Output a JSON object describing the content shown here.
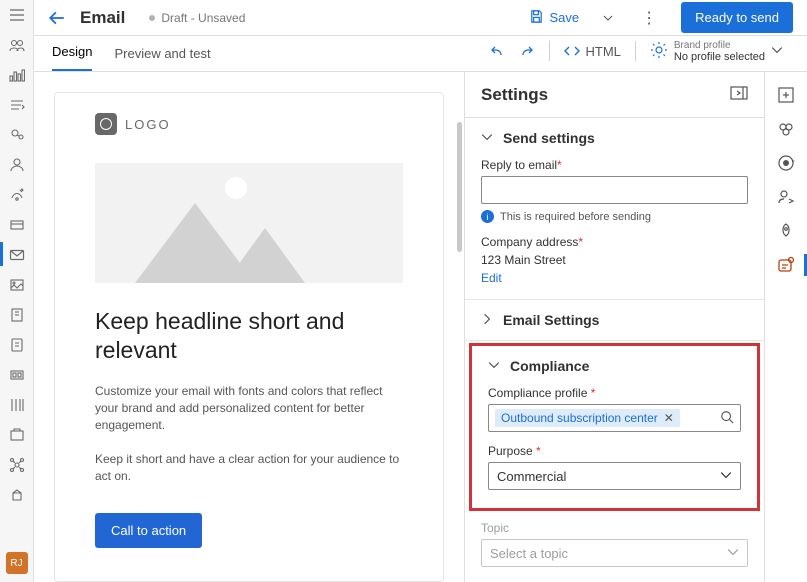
{
  "header": {
    "page_title": "Email",
    "draft_status": "Draft - Unsaved",
    "save_label": "Save",
    "ready_label": "Ready to send"
  },
  "ribbon": {
    "tabs": {
      "design": "Design",
      "preview": "Preview and test"
    },
    "html_label": "HTML",
    "brand_small": "Brand profile",
    "brand_value": "No profile selected"
  },
  "email": {
    "logo_text": "LOGO",
    "headline": "Keep headline short and relevant",
    "body1": "Customize your email with fonts and colors that reflect your brand and add personalized content for better engagement.",
    "body2": "Keep it short and have a clear action for your audience to act on.",
    "cta": "Call to action"
  },
  "panel": {
    "title": "Settings",
    "send": {
      "title": "Send settings",
      "reply_label": "Reply to email",
      "reply_info": "This is required before sending",
      "company_label": "Company address",
      "company_value": "123 Main Street",
      "edit": "Edit"
    },
    "email_settings": {
      "title": "Email Settings"
    },
    "compliance": {
      "title": "Compliance",
      "profile_label": "Compliance profile",
      "profile_value": "Outbound subscription center",
      "purpose_label": "Purpose",
      "purpose_value": "Commercial"
    },
    "topic": {
      "label": "Topic",
      "placeholder": "Select a topic"
    }
  },
  "badge": "RJ"
}
